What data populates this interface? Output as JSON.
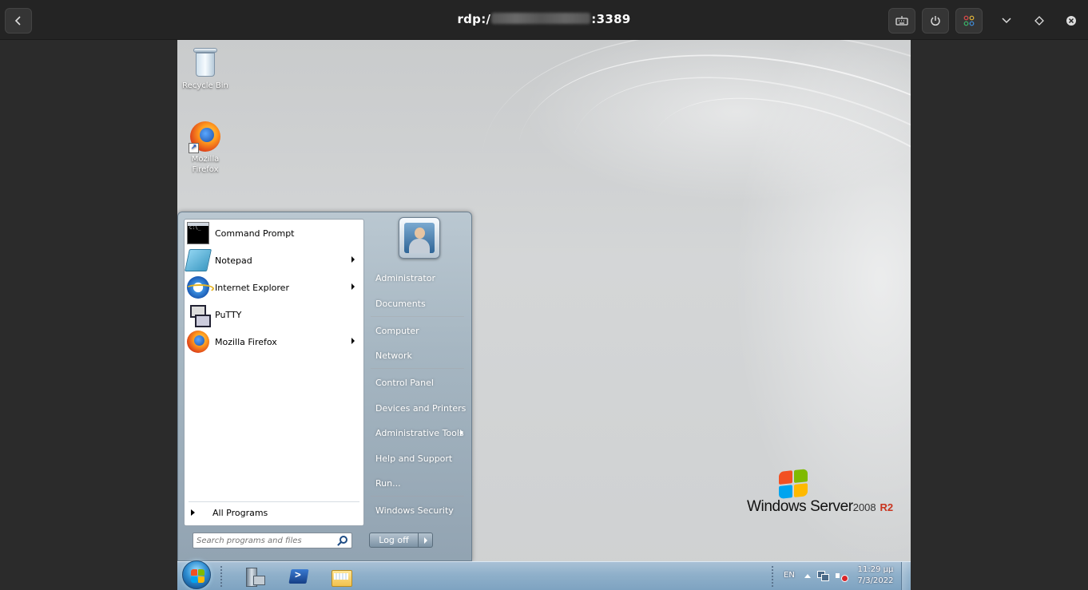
{
  "client": {
    "title_prefix": "rdp:/",
    "title_suffix": ":3389"
  },
  "desktop": {
    "icons": [
      {
        "label": "Recycle Bin"
      },
      {
        "label": "Mozilla Firefox"
      }
    ]
  },
  "start_menu": {
    "programs": [
      {
        "label": "Command Prompt",
        "icon": "command-prompt-icon",
        "submenu": false
      },
      {
        "label": "Notepad",
        "icon": "notepad-icon",
        "submenu": true
      },
      {
        "label": "Internet Explorer",
        "icon": "internet-explorer-icon",
        "submenu": true
      },
      {
        "label": "PuTTY",
        "icon": "putty-icon",
        "submenu": false
      },
      {
        "label": "Mozilla Firefox",
        "icon": "firefox-icon",
        "submenu": true
      }
    ],
    "all_programs": "All Programs",
    "search_placeholder": "Search programs and files",
    "right_items": [
      {
        "label": "Administrator"
      },
      {
        "label": "Documents"
      },
      {
        "label": "Computer"
      },
      {
        "label": "Network"
      },
      {
        "label": "Control Panel"
      },
      {
        "label": "Devices and Printers"
      },
      {
        "label": "Administrative Tools",
        "submenu": true
      },
      {
        "label": "Help and Support"
      },
      {
        "label": "Run..."
      },
      {
        "label": "Windows Security"
      }
    ],
    "log_off": "Log off"
  },
  "branding": {
    "name": "Windows Server",
    "version": "2008",
    "edition": "R2"
  },
  "taskbar": {
    "language": "EN",
    "time": "11:29 μμ",
    "date": "7/3/2022"
  },
  "colors": {
    "accent_red": "#c9341e",
    "taskbar": "#8fb0ca"
  }
}
